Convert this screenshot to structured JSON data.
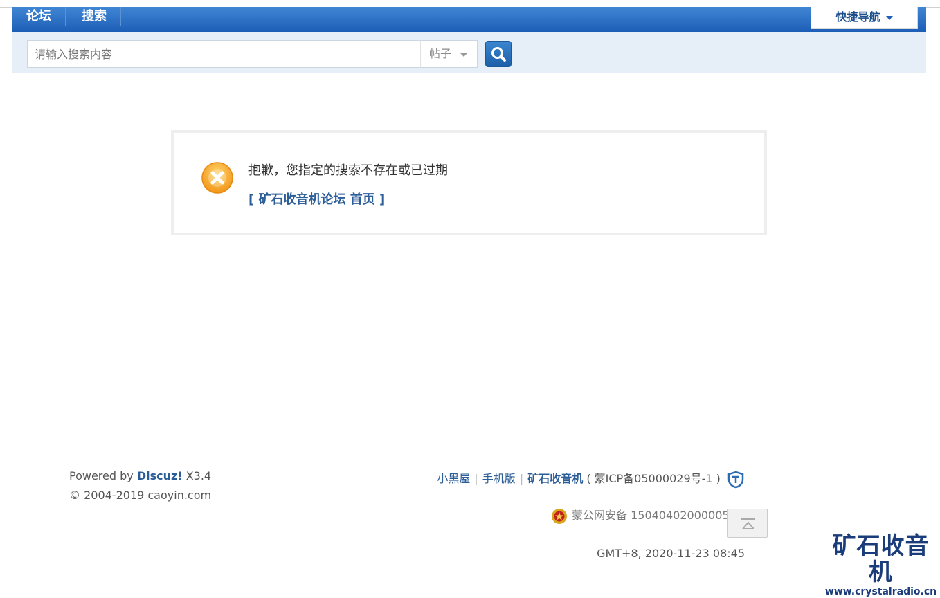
{
  "nav": {
    "items": [
      "论坛",
      "搜索"
    ],
    "quick_nav": "快捷导航"
  },
  "search": {
    "placeholder": "请输入搜索内容",
    "type_selected": "帖子"
  },
  "message": {
    "text": "抱歉，您指定的搜索不存在或已过期",
    "link": "[ 矿石收音机论坛 首页 ]"
  },
  "footer": {
    "powered_prefix": "Powered by",
    "powered_brand": "Discuz!",
    "powered_version": "X3.4",
    "copyright": "© 2004-2019 caoyin.com",
    "links": [
      "小黑屋",
      "手机版",
      "矿石收音机"
    ],
    "icp": "( 蒙ICP备05000029号-1 )",
    "police": "蒙公网安备 15040402000005号",
    "gmt": "GMT+8, 2020-11-23 08:45"
  },
  "brand": {
    "cn": "矿石收音机",
    "en": "www.crystalradio.cn"
  },
  "colors": {
    "nav_blue": "#1d5eb6",
    "link_blue": "#2b5d98",
    "error_orange": "#f7a234"
  }
}
